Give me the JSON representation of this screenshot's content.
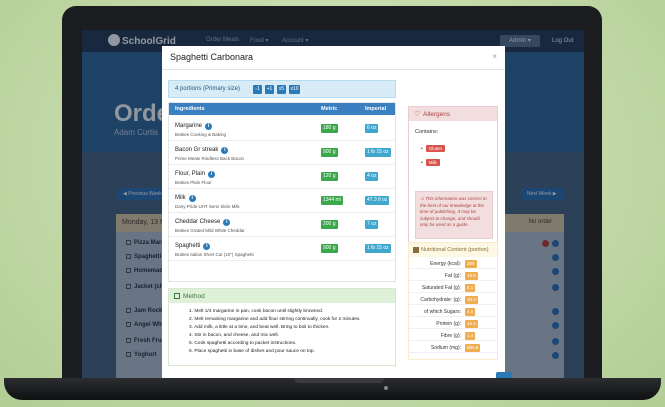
{
  "background_site": {
    "logo": "SchoolGrid",
    "nav": [
      "Order Meals",
      "Food ▾",
      "Account ▾"
    ],
    "admin": "Admin ▾",
    "logout": "Log Out",
    "title": "Orde",
    "subtitle": "Adam Curtis",
    "prev_week": "◀ Previous Week",
    "next_week": "Next Week ▶",
    "day": "Monday, 13 M",
    "no_order": "No order",
    "items": [
      "Pizza Marghe",
      "Spaghetti C",
      "Homemade",
      "Jacket (choi",
      "Jam Rock B",
      "Angel Whip",
      "Fresh Fruit",
      "Yoghurt"
    ]
  },
  "modal": {
    "title": "Spaghetti Carbonara",
    "close": "×",
    "portions": {
      "label": "4 portions (Primary size)",
      "buttons": [
        "-1",
        "+1",
        "x5",
        "x10"
      ]
    },
    "table": {
      "headers": [
        "Ingredients",
        "Metric",
        "Imperial"
      ],
      "rows": [
        {
          "name": "Margarine",
          "brand": "Brakes Cooking & Baking",
          "metric": "180 g",
          "imperial": "6 oz"
        },
        {
          "name": "Bacon Gr streak",
          "brand": "Prime Meats Rindless Back Bacon",
          "metric": "900 g",
          "imperial": "1 lb 15 oz"
        },
        {
          "name": "Flour, Plain",
          "brand": "Brakes Plain Flour",
          "metric": "120 g",
          "imperial": "4 oz"
        },
        {
          "name": "Milk",
          "brand": "Dairy Pride UHT Semi Skim Milk",
          "metric": "1344 ml",
          "imperial": "47.3 fl oz"
        },
        {
          "name": "Cheddar Cheese",
          "brand": "Brakes Grated Mild White Cheddar",
          "metric": "200 g",
          "imperial": "7 oz"
        },
        {
          "name": "Spaghetti",
          "brand": "Brakes Italian Short Cut (10\") Spaghetti",
          "metric": "900 g",
          "imperial": "1 lb 15 oz"
        }
      ]
    },
    "method": {
      "title": "Method",
      "steps": [
        "1. Melt 1/4 margarine in pan, cook bacon until slightly browned.",
        "2. Melt remaining margarine and add flour stirring continually, cook for 2 minutes.",
        "3. Add milk, a little at a time, and beat well. Bring to boil to thicken.",
        "4. Stir in bacon, and cheese, and mix well.",
        "5. Cook spaghetti according to packet instructions.",
        "6. Place spaghetti in base of dishes and pour sauce on top."
      ]
    },
    "allergens": {
      "title": "Allergens",
      "contains_label": "Contains:",
      "items": [
        "Gluten",
        "Milk"
      ],
      "warning": "This information was correct to the best of our knowledge at the time of publishing. It may be subject to change, and should only be used as a guide."
    },
    "nutrition": {
      "title": "Nutritional Content",
      "subtitle": "(portion)",
      "rows": [
        {
          "label": "Energy (kcal):",
          "value": "380"
        },
        {
          "label": "Fat (g):",
          "value": "18.8"
        },
        {
          "label": "Saturated Fat (g):",
          "value": "8.1"
        },
        {
          "label": "Carbohydrate: (g):",
          "value": "38.3"
        },
        {
          "label": "of which Sugars:",
          "value": "4.5"
        },
        {
          "label": "Protein (g):",
          "value": "16.4"
        },
        {
          "label": "Fibre (g):",
          "value": "1.4"
        },
        {
          "label": "Sodium (mg):",
          "value": "880.8"
        }
      ]
    }
  }
}
